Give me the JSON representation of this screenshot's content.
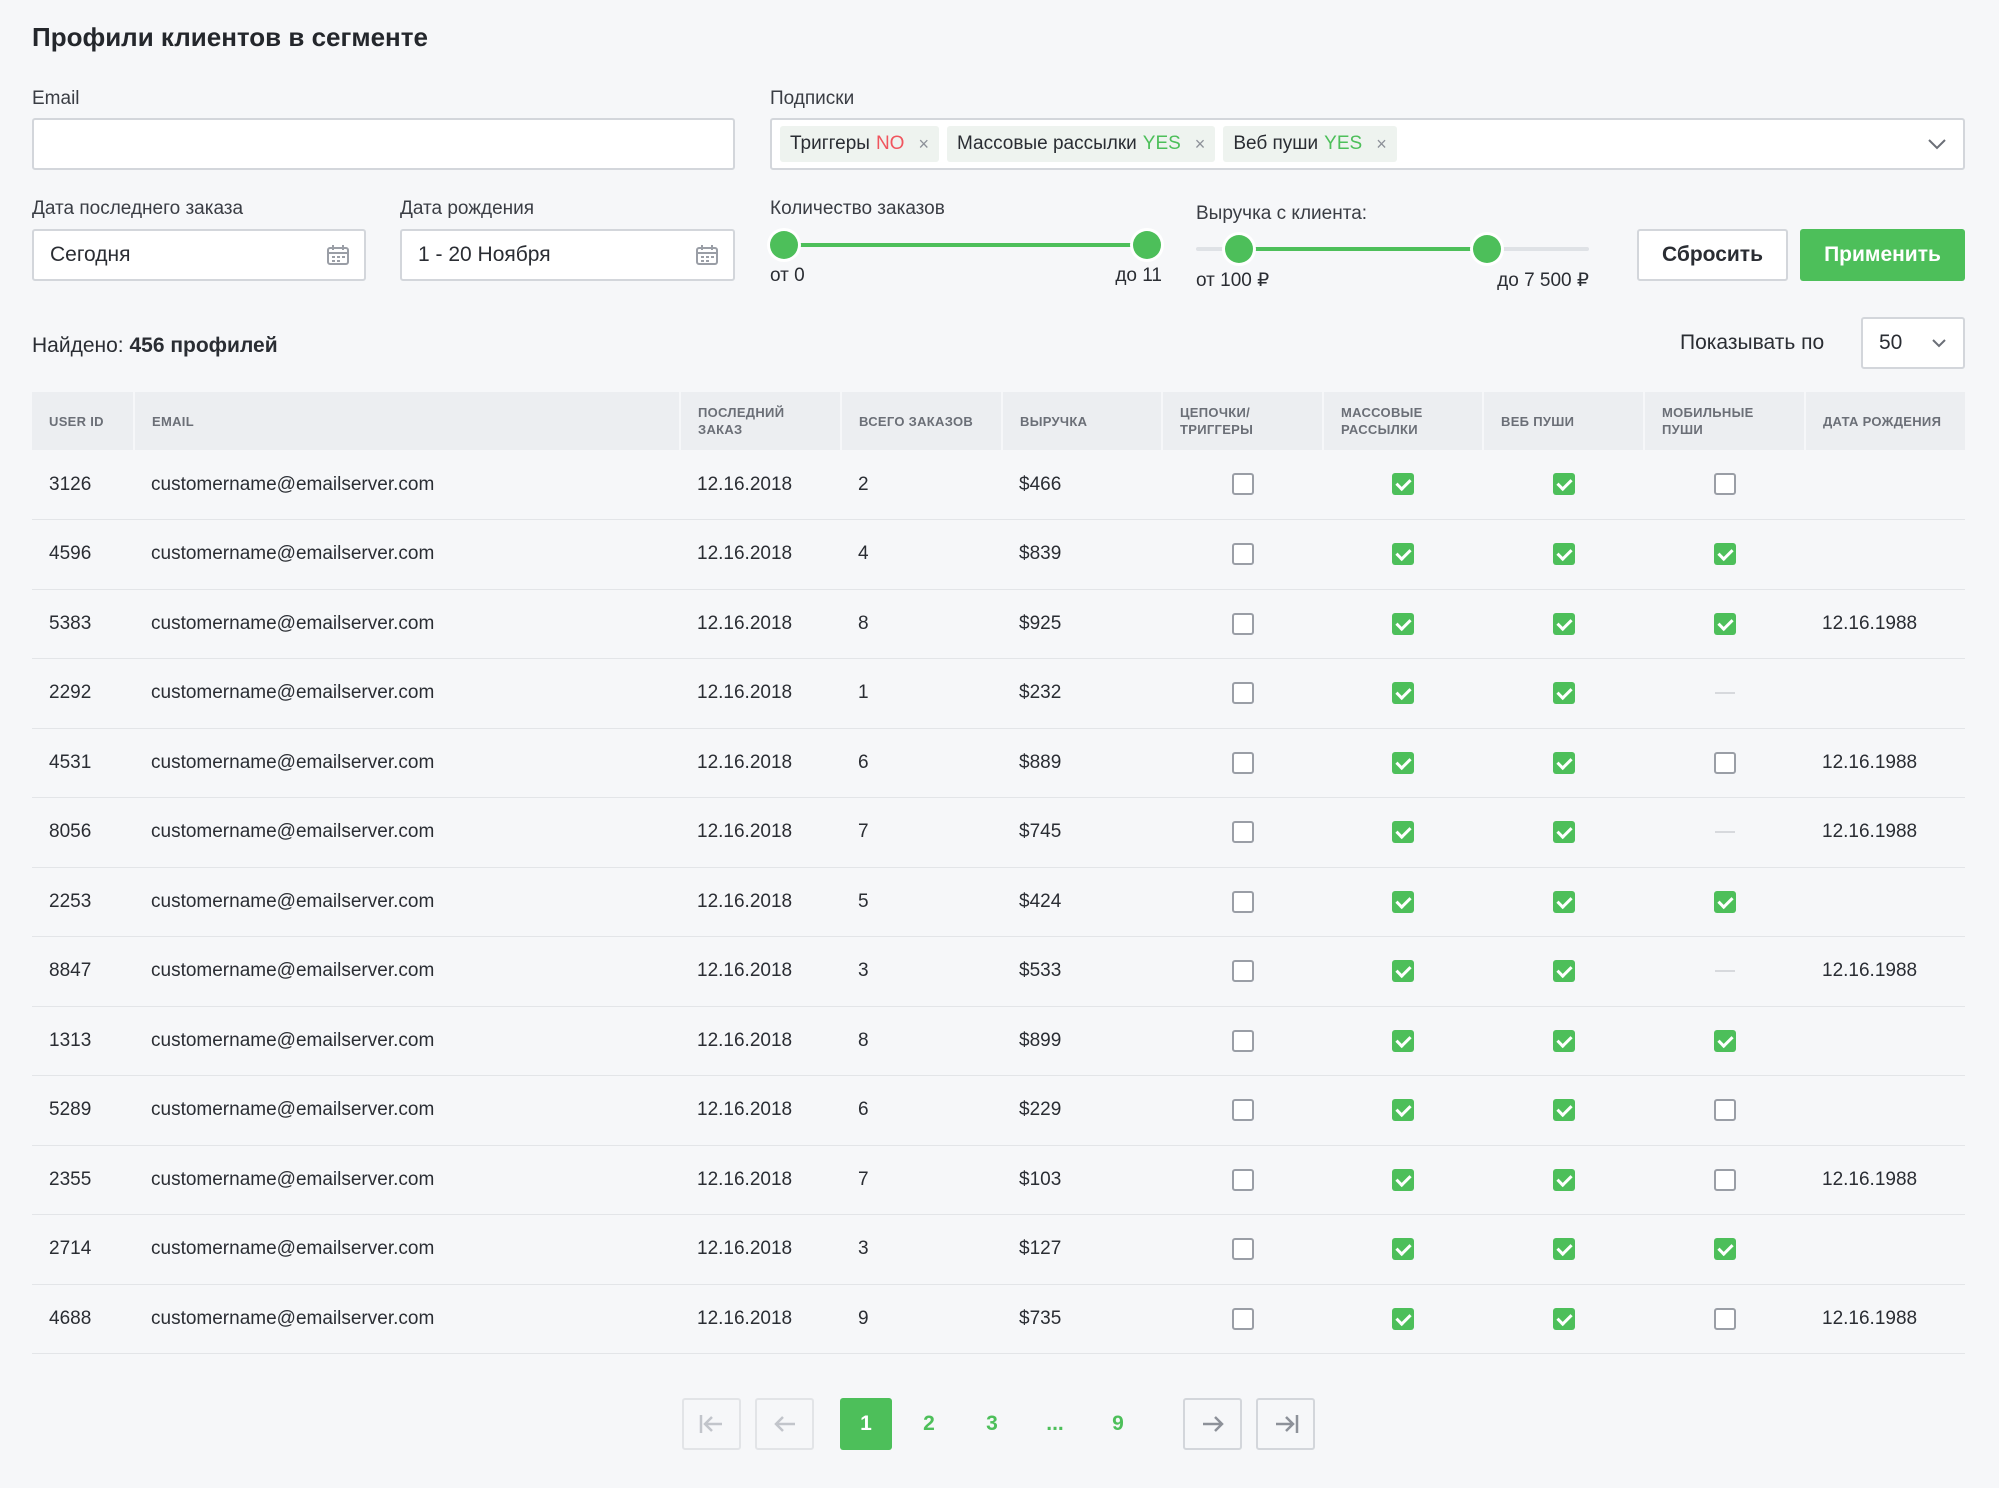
{
  "page": {
    "title": "Профили клиентов в сегменте"
  },
  "filters": {
    "email_label": "Email",
    "email_value": "",
    "subs_label": "Подписки",
    "tags": [
      {
        "name": "Триггеры",
        "value": "NO",
        "remove": "×"
      },
      {
        "name": "Массовые рассылки",
        "value": "YES",
        "remove": "×"
      },
      {
        "name": "Веб пуши",
        "value": "YES",
        "remove": "×"
      }
    ],
    "last_order_label": "Дата последнего заказа",
    "last_order_value": "Сегодня",
    "birthday_label": "Дата рождения",
    "birthday_value": "1 - 20 Ноября",
    "orders_label": "Количество заказов",
    "orders_from": "от 0",
    "orders_to": "до 11",
    "orders_range": {
      "min_frac": 0.0,
      "max_frac": 1.0
    },
    "revenue_label": "Выручка с клиента:",
    "revenue_from": "от 100 ₽",
    "revenue_to": "до 7 500 ₽",
    "revenue_range": {
      "min_frac": 0.11,
      "max_frac": 0.74
    },
    "reset_label": "Сбросить",
    "apply_label": "Применить"
  },
  "results": {
    "found_prefix": "Найдено:",
    "found_value": "456 профилей",
    "per_page_label": "Показывать по",
    "per_page_value": "50"
  },
  "table": {
    "headers": [
      "USER ID",
      "EMAIL",
      "ПОСЛЕДНИЙ ЗАКАЗ",
      "ВСЕГО ЗАКАЗОВ",
      "ВЫРУЧКА",
      "ЦЕПОЧКИ/ ТРИГГЕРЫ",
      "МАССОВЫЕ РАССЫЛКИ",
      "ВЕБ ПУШИ",
      "МОБИЛЬНЫЕ ПУШИ",
      "ДАТА РОЖДЕНИЯ"
    ],
    "rows": [
      {
        "id": "3126",
        "email": "customername@emailserver.com",
        "last": "12.16.2018",
        "orders": "2",
        "revenue": "$466",
        "triggers": false,
        "mass": true,
        "web": true,
        "mobile": false,
        "birth": ""
      },
      {
        "id": "4596",
        "email": "customername@emailserver.com",
        "last": "12.16.2018",
        "orders": "4",
        "revenue": "$839",
        "triggers": false,
        "mass": true,
        "web": true,
        "mobile": true,
        "birth": ""
      },
      {
        "id": "5383",
        "email": "customername@emailserver.com",
        "last": "12.16.2018",
        "orders": "8",
        "revenue": "$925",
        "triggers": false,
        "mass": true,
        "web": true,
        "mobile": true,
        "birth": "12.16.1988"
      },
      {
        "id": "2292",
        "email": "customername@emailserver.com",
        "last": "12.16.2018",
        "orders": "1",
        "revenue": "$232",
        "triggers": false,
        "mass": true,
        "web": true,
        "mobile": null,
        "birth": ""
      },
      {
        "id": "4531",
        "email": "customername@emailserver.com",
        "last": "12.16.2018",
        "orders": "6",
        "revenue": "$889",
        "triggers": false,
        "mass": true,
        "web": true,
        "mobile": false,
        "birth": "12.16.1988"
      },
      {
        "id": "8056",
        "email": "customername@emailserver.com",
        "last": "12.16.2018",
        "orders": "7",
        "revenue": "$745",
        "triggers": false,
        "mass": true,
        "web": true,
        "mobile": null,
        "birth": "12.16.1988"
      },
      {
        "id": "2253",
        "email": "customername@emailserver.com",
        "last": "12.16.2018",
        "orders": "5",
        "revenue": "$424",
        "triggers": false,
        "mass": true,
        "web": true,
        "mobile": true,
        "birth": ""
      },
      {
        "id": "8847",
        "email": "customername@emailserver.com",
        "last": "12.16.2018",
        "orders": "3",
        "revenue": "$533",
        "triggers": false,
        "mass": true,
        "web": true,
        "mobile": null,
        "birth": "12.16.1988"
      },
      {
        "id": "1313",
        "email": "customername@emailserver.com",
        "last": "12.16.2018",
        "orders": "8",
        "revenue": "$899",
        "triggers": false,
        "mass": true,
        "web": true,
        "mobile": true,
        "birth": ""
      },
      {
        "id": "5289",
        "email": "customername@emailserver.com",
        "last": "12.16.2018",
        "orders": "6",
        "revenue": "$229",
        "triggers": false,
        "mass": true,
        "web": true,
        "mobile": false,
        "birth": ""
      },
      {
        "id": "2355",
        "email": "customername@emailserver.com",
        "last": "12.16.2018",
        "orders": "7",
        "revenue": "$103",
        "triggers": false,
        "mass": true,
        "web": true,
        "mobile": false,
        "birth": "12.16.1988"
      },
      {
        "id": "2714",
        "email": "customername@emailserver.com",
        "last": "12.16.2018",
        "orders": "3",
        "revenue": "$127",
        "triggers": false,
        "mass": true,
        "web": true,
        "mobile": true,
        "birth": ""
      },
      {
        "id": "4688",
        "email": "customername@emailserver.com",
        "last": "12.16.2018",
        "orders": "9",
        "revenue": "$735",
        "triggers": false,
        "mass": true,
        "web": true,
        "mobile": false,
        "birth": "12.16.1988"
      }
    ]
  },
  "pagination": {
    "pages": [
      "1",
      "2",
      "3",
      "...",
      "9"
    ],
    "active": "1",
    "icons": [
      "first-page-icon",
      "prev-page-icon",
      "next-page-icon",
      "last-page-icon"
    ]
  },
  "colors": {
    "accent": "#4dbf5a",
    "negative": "#f0555e",
    "background": "#f6f7f9"
  }
}
